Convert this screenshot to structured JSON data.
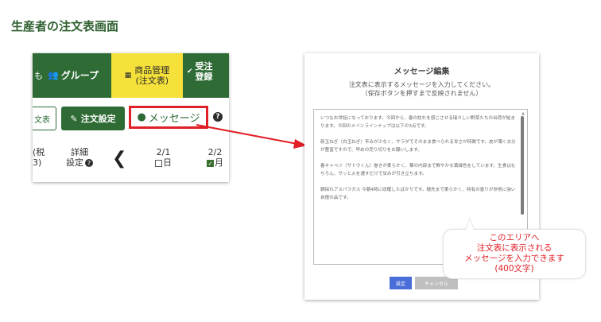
{
  "page_title": "生産者の注文表画面",
  "left_panel": {
    "nav": {
      "left_cut_label": "も",
      "group_label": "グループ",
      "product_mgmt_line1": "商品管理",
      "product_mgmt_line2": "(注文表)",
      "order_line1": "受注",
      "order_line2": "登録"
    },
    "toolbar": {
      "table_btn": "文表",
      "settings_btn": "注文設定",
      "message_btn": "メッセージ"
    },
    "header_row": {
      "tax_line1": "(税",
      "tax_line2": "3)",
      "detail_line1": "詳細",
      "detail_line2": "設定",
      "date1": "2/1",
      "date1_day": "日",
      "date2": "2/2",
      "date2_day": "月"
    }
  },
  "dialog": {
    "title": "メッセージ編集",
    "desc_line1": "注文表に表示するメッセージを入力してください。",
    "desc_line2": "（保存ボタンを押すまで反映されません）",
    "paragraphs": [
      "いつもお世話になっております。今回から、春の訪れを感じさせる瑞々しい野菜たちの出荷が始まります。今回のメインラインナップは以下の3点です。",
      "新玉ねぎ（白玉ねぎ）辛みが少なく、サラダでそのまま食べられる甘さが特徴です。皮が薄く水分が豊富ですので、早めの売り切りをお願いします。",
      "春キャベツ（サトウくん）巻きが柔らかく、葉の内部まで鮮やかな黄緑色をしています。生食はもちろん、サッと火を通すだけで甘みが引き立ちます。",
      "朝採れアスパラガス 今朝4時に収穫したばかりです。穂先まで柔らかく、特有の香りが非常に強い自慢の品です。"
    ],
    "save_btn": "設定",
    "cancel_btn": "キャンセル"
  },
  "callout": {
    "line1": "このエリアへ",
    "line2": "注文表に表示される",
    "line3": "メッセージを入力できます",
    "line4": "(400文字)"
  },
  "colors": {
    "brand_green": "#2e6b35",
    "highlight_yellow": "#f5e13a",
    "annotation_red": "#e11f26",
    "save_blue": "#4a6ed8"
  }
}
